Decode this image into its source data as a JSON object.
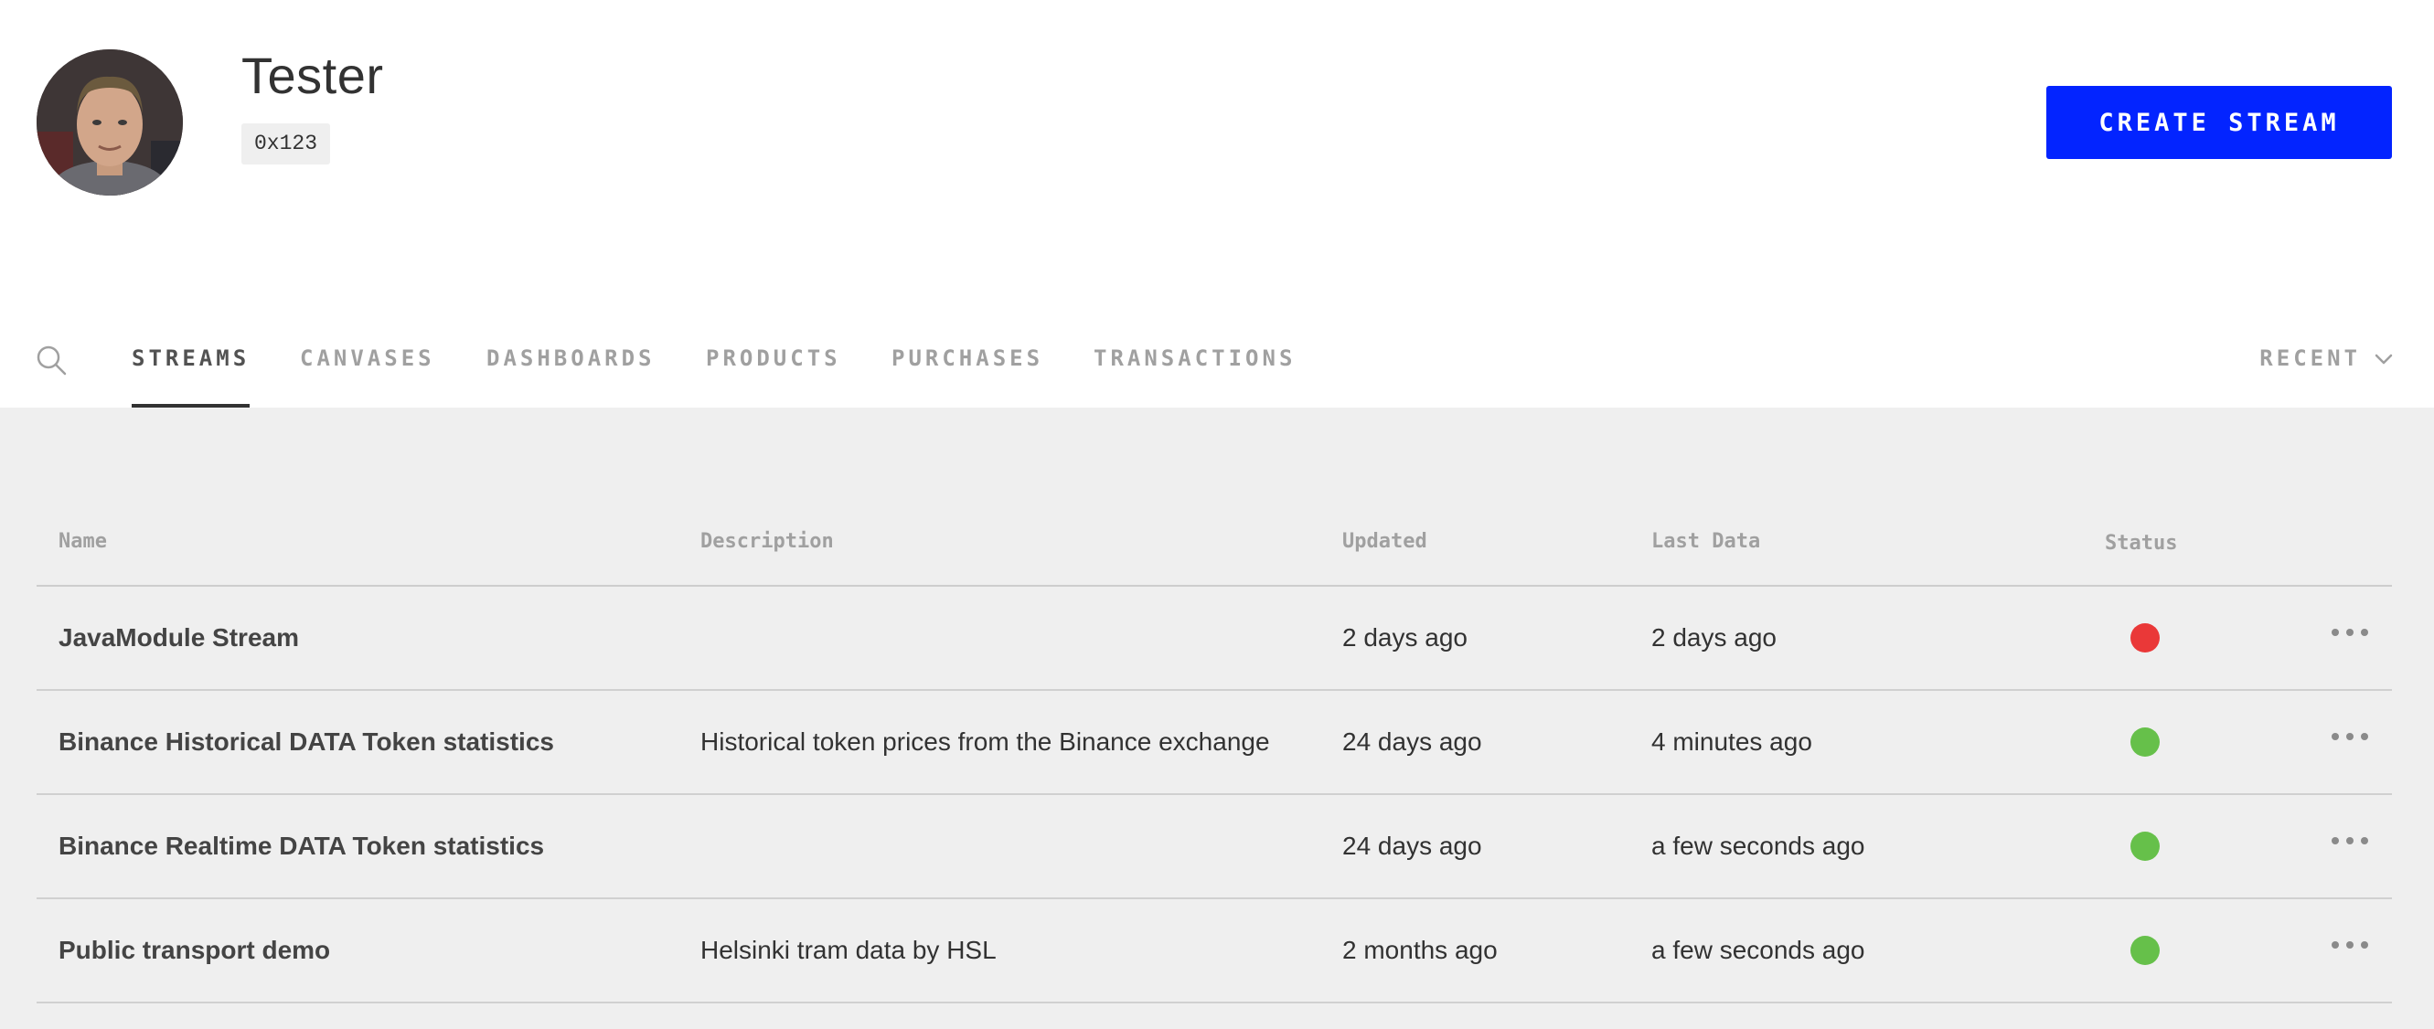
{
  "user": {
    "name": "Tester",
    "address": "0x123"
  },
  "actions": {
    "create_stream": "CREATE STREAM"
  },
  "tabs": [
    {
      "label": "STREAMS",
      "active": true
    },
    {
      "label": "CANVASES",
      "active": false
    },
    {
      "label": "DASHBOARDS",
      "active": false
    },
    {
      "label": "PRODUCTS",
      "active": false
    },
    {
      "label": "PURCHASES",
      "active": false
    },
    {
      "label": "TRANSACTIONS",
      "active": false
    }
  ],
  "sort": {
    "label": "RECENT"
  },
  "table": {
    "columns": {
      "name": "Name",
      "description": "Description",
      "updated": "Updated",
      "last_data": "Last Data",
      "status": "Status"
    },
    "rows": [
      {
        "name": "JavaModule Stream",
        "description": "",
        "updated": "2 days ago",
        "last_data": "2 days ago",
        "status": "error"
      },
      {
        "name": "Binance Historical DATA Token statistics",
        "description": "Historical token prices from the Binance exchange",
        "updated": "24 days ago",
        "last_data": "4 minutes ago",
        "status": "ok"
      },
      {
        "name": "Binance Realtime DATA Token statistics",
        "description": "",
        "updated": "24 days ago",
        "last_data": "a few seconds ago",
        "status": "ok"
      },
      {
        "name": "Public transport demo",
        "description": "Helsinki tram data by HSL",
        "updated": "2 months ago",
        "last_data": "a few seconds ago",
        "status": "ok"
      }
    ]
  },
  "colors": {
    "accent": "#0324ff",
    "status_ok": "#66c04a",
    "status_error": "#ea3838",
    "content_bg": "#efefef"
  },
  "icons": {
    "search": "search-icon",
    "sort_chevron": "chevron-down-icon",
    "row_menu": "more-horizontal-icon"
  }
}
